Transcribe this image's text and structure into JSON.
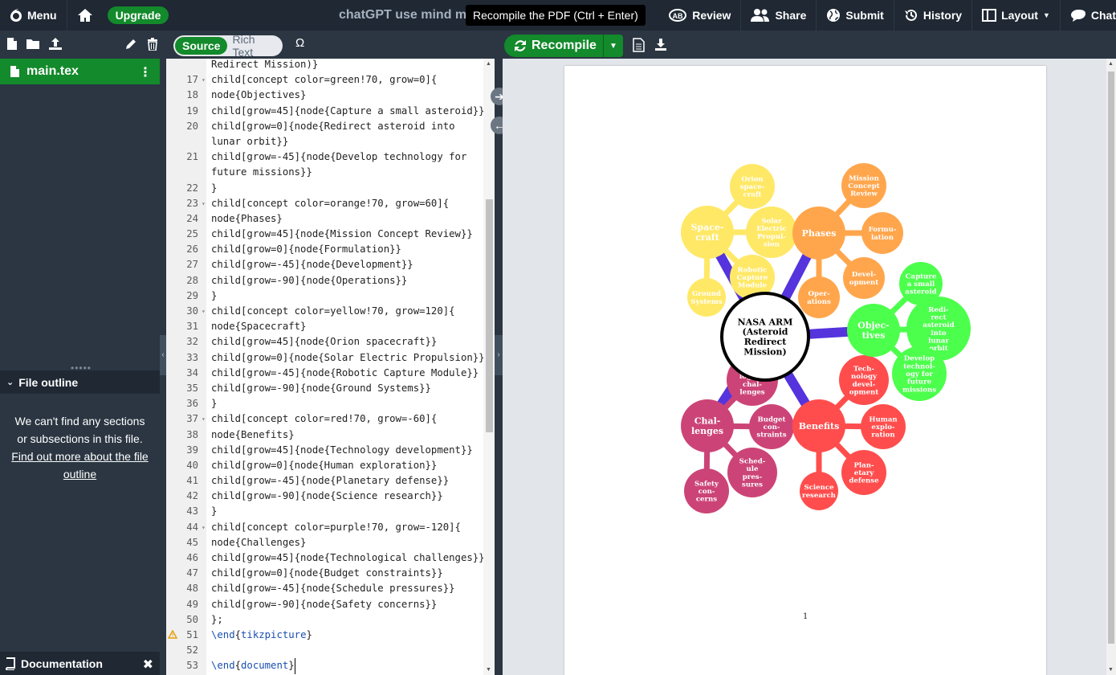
{
  "topbar": {
    "menu": "Menu",
    "upgrade": "Upgrade",
    "project_title": "chatGPT use mind map",
    "tooltip": "Recompile the PDF (Ctrl + Enter)",
    "review": "Review",
    "share": "Share",
    "submit": "Submit",
    "history": "History",
    "layout": "Layout",
    "chat": "Chat"
  },
  "toolbar": {
    "source": "Source",
    "rich_text": "Rich Text",
    "recompile": "Recompile"
  },
  "file_tree": {
    "active_file": "main.tex"
  },
  "outline": {
    "title": "File outline",
    "empty_message": "We can't find any sections or subsections in this file.",
    "link": "Find out more about the file outline"
  },
  "documentation": {
    "label": "Documentation"
  },
  "code_lines": [
    {
      "n": "",
      "t": "Redirect Mission)}"
    },
    {
      "n": "17",
      "t": "child[concept color=green!70, grow=0]{",
      "fold": true
    },
    {
      "n": "18",
      "t": "node{Objectives}"
    },
    {
      "n": "19",
      "t": "child[grow=45]{node{Capture a small asteroid}}"
    },
    {
      "n": "20",
      "t": "child[grow=0]{node{Redirect asteroid into"
    },
    {
      "n": "",
      "t": "lunar orbit}}"
    },
    {
      "n": "21",
      "t": "child[grow=-45]{node{Develop technology for"
    },
    {
      "n": "",
      "t": "future missions}}"
    },
    {
      "n": "22",
      "t": "}"
    },
    {
      "n": "23",
      "t": "child[concept color=orange!70, grow=60]{",
      "fold": true
    },
    {
      "n": "24",
      "t": "node{Phases}"
    },
    {
      "n": "25",
      "t": "child[grow=45]{node{Mission Concept Review}}"
    },
    {
      "n": "26",
      "t": "child[grow=0]{node{Formulation}}"
    },
    {
      "n": "27",
      "t": "child[grow=-45]{node{Development}}"
    },
    {
      "n": "28",
      "t": "child[grow=-90]{node{Operations}}"
    },
    {
      "n": "29",
      "t": "}"
    },
    {
      "n": "30",
      "t": "child[concept color=yellow!70, grow=120]{",
      "fold": true
    },
    {
      "n": "31",
      "t": "node{Spacecraft}"
    },
    {
      "n": "32",
      "t": "child[grow=45]{node{Orion spacecraft}}"
    },
    {
      "n": "33",
      "t": "child[grow=0]{node{Solar Electric Propulsion}}"
    },
    {
      "n": "34",
      "t": "child[grow=-45]{node{Robotic Capture Module}}"
    },
    {
      "n": "35",
      "t": "child[grow=-90]{node{Ground Systems}}"
    },
    {
      "n": "36",
      "t": "}"
    },
    {
      "n": "37",
      "t": "child[concept color=red!70, grow=-60]{",
      "fold": true
    },
    {
      "n": "38",
      "t": "node{Benefits}"
    },
    {
      "n": "39",
      "t": "child[grow=45]{node{Technology development}}"
    },
    {
      "n": "40",
      "t": "child[grow=0]{node{Human exploration}}"
    },
    {
      "n": "41",
      "t": "child[grow=-45]{node{Planetary defense}}"
    },
    {
      "n": "42",
      "t": "child[grow=-90]{node{Science research}}"
    },
    {
      "n": "43",
      "t": "}"
    },
    {
      "n": "44",
      "t": "child[concept color=purple!70, grow=-120]{",
      "fold": true
    },
    {
      "n": "45",
      "t": "node{Challenges}"
    },
    {
      "n": "46",
      "t": "child[grow=45]{node{Technological challenges}}"
    },
    {
      "n": "47",
      "t": "child[grow=0]{node{Budget constraints}}"
    },
    {
      "n": "48",
      "t": "child[grow=-45]{node{Schedule pressures}}"
    },
    {
      "n": "49",
      "t": "child[grow=-90]{node{Safety concerns}}"
    },
    {
      "n": "50",
      "t": "};"
    },
    {
      "n": "51",
      "t": "\\end{tikzpicture}",
      "warn": true,
      "kw": true
    },
    {
      "n": "52",
      "t": ""
    },
    {
      "n": "53",
      "t": "\\end{document}",
      "kw": true,
      "cursor": true
    }
  ],
  "mindmap": {
    "center": [
      "NASA ARM",
      "(Asteroid",
      "Redirect",
      "Mission)"
    ],
    "objectives": {
      "color": "#4cff4c",
      "label": [
        "Objec-",
        "tives"
      ],
      "children": [
        [
          "Capture",
          "a small",
          "asteroid"
        ],
        [
          "Redi-",
          "rect",
          "asteroid",
          "into",
          "lunar",
          "orbit"
        ],
        [
          "Develop",
          "technol-",
          "ogy for",
          "future",
          "missions"
        ]
      ]
    },
    "phases": {
      "color": "#ffa64d",
      "label": [
        "Phases"
      ],
      "children": [
        [
          "Mission",
          "Concept",
          "Review"
        ],
        [
          "Formu-",
          "lation"
        ],
        [
          "Devel-",
          "opment"
        ],
        [
          "Oper-",
          "ations"
        ]
      ]
    },
    "spacecraft": {
      "color": "#ffe866",
      "label": [
        "Space-",
        "craft"
      ],
      "children": [
        [
          "Orion",
          "space-",
          "craft"
        ],
        [
          "Solar",
          "Electric",
          "Propul-",
          "sion"
        ],
        [
          "Robotic",
          "Capture",
          "Module"
        ],
        [
          "Ground",
          "Systems"
        ]
      ]
    },
    "benefits": {
      "color": "#ff4d4d",
      "label": [
        "Benefits"
      ],
      "children": [
        [
          "Tech-",
          "nology",
          "devel-",
          "opment"
        ],
        [
          "Human",
          "explo-",
          "ration"
        ],
        [
          "Plan-",
          "etary",
          "defense"
        ],
        [
          "Science",
          "research"
        ]
      ]
    },
    "challenges": {
      "color": "#cc4477",
      "label": [
        "Chal-",
        "lenges"
      ],
      "children": [
        [
          "Techno-",
          "logical",
          "chal-",
          "lenges"
        ],
        [
          "Budget",
          "con-",
          "straints"
        ],
        [
          "Sched-",
          "ule",
          "pres-",
          "sures"
        ],
        [
          "Safety",
          "con-",
          "cerns"
        ]
      ]
    },
    "page_number": "1"
  }
}
